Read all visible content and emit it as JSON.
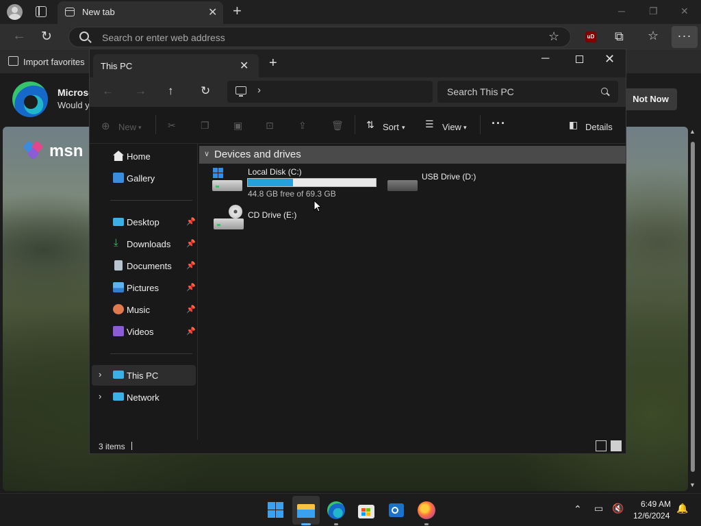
{
  "edge": {
    "tab_title": "New tab",
    "address_placeholder": "Search or enter web address",
    "import_favorites": "Import favorites",
    "ublock_label": "uD"
  },
  "ntp": {
    "promo_title": "Microso",
    "promo_subtitle": "Would y",
    "not_now": "Not Now",
    "msn_label": "msn"
  },
  "explorer": {
    "tab_title": "This PC",
    "search_placeholder": "Search This PC",
    "commands": {
      "new": "New",
      "sort": "Sort",
      "view": "View",
      "details": "Details"
    },
    "sidebar": {
      "quick": [
        {
          "label": "Home",
          "color": "#e8e8e8"
        },
        {
          "label": "Gallery",
          "color": "#3a8dde"
        }
      ],
      "pinned": [
        {
          "label": "Desktop",
          "color": "#3ab0e6"
        },
        {
          "label": "Downloads",
          "color": "#37c26c"
        },
        {
          "label": "Documents",
          "color": "#b8c4d0"
        },
        {
          "label": "Pictures",
          "color": "#3a8dde"
        },
        {
          "label": "Music",
          "color": "#e0794d"
        },
        {
          "label": "Videos",
          "color": "#8b5cd6"
        }
      ],
      "locations": [
        {
          "label": "This PC",
          "color": "#3ab0e6"
        },
        {
          "label": "Network",
          "color": "#3ab0e6"
        }
      ]
    },
    "group_title": "Devices and drives",
    "drives": [
      {
        "name": "Local Disk (C:)",
        "free": "44.8 GB free of 69.3 GB",
        "used_fraction": 0.354
      },
      {
        "name": "USB Drive (D:)"
      },
      {
        "name": "CD Drive (E:)"
      }
    ],
    "status": "3 items"
  },
  "taskbar": {
    "time": "6:49 AM",
    "date": "12/6/2024"
  }
}
